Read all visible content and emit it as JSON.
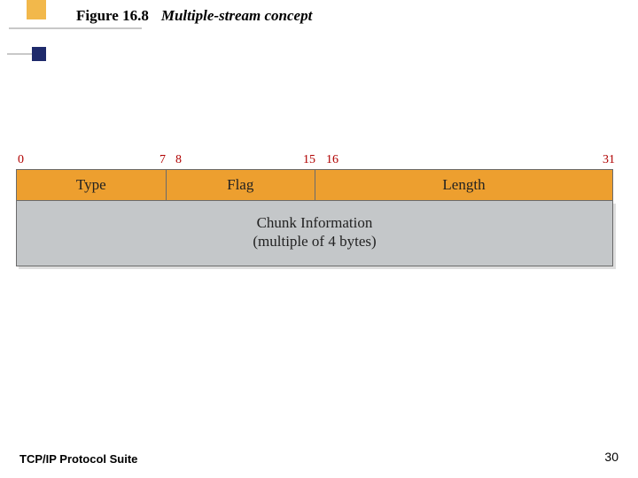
{
  "figure": {
    "number": "Figure 16.8",
    "title": "Multiple-stream concept"
  },
  "bits": {
    "b0": "0",
    "b7": "7",
    "b8": "8",
    "b15": "15",
    "b16": "16",
    "b31": "31"
  },
  "header": {
    "type": "Type",
    "flag": "Flag",
    "length": "Length"
  },
  "body": {
    "line1": "Chunk Information",
    "line2": "(multiple of 4 bytes)"
  },
  "footer": {
    "suite": "TCP/IP Protocol Suite",
    "page": "30"
  },
  "colors": {
    "accent_gold": "#f2b84b",
    "accent_navy": "#1e2a6b",
    "header_orange": "#ed9f2f",
    "body_gray": "#c4c7c9",
    "bit_red": "#b00000"
  }
}
